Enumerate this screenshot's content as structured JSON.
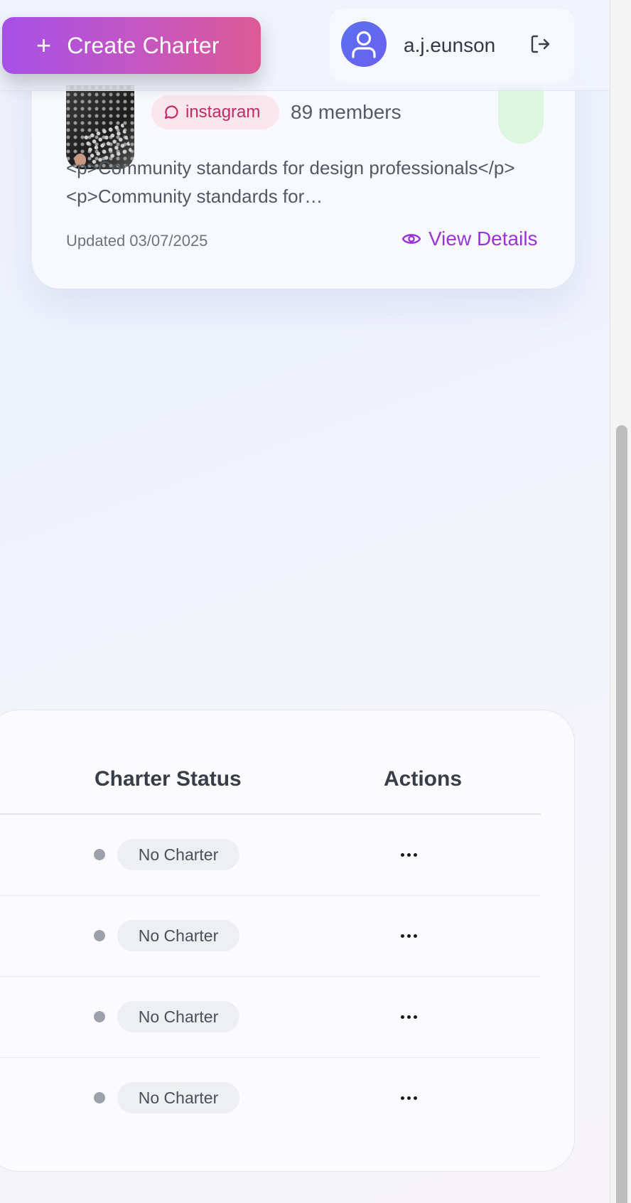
{
  "header": {
    "create_button_label": "Create Charter",
    "username": "a.j.eunson"
  },
  "charter_card": {
    "platform": "instagram",
    "members": "89 members",
    "description": "<p>Community standards for design professionals</p><p>Community standards for…",
    "updated": "Updated 03/07/2025",
    "view_details_label": "View Details"
  },
  "table": {
    "columns": [
      "Charter Status",
      "Actions"
    ],
    "rows": [
      {
        "status": "No Charter"
      },
      {
        "status": "No Charter"
      },
      {
        "status": "No Charter"
      },
      {
        "status": "No Charter"
      }
    ]
  },
  "colors": {
    "accent_gradient_start": "#a650e8",
    "accent_gradient_end": "#dd5a96",
    "link_purple": "#9a34d8",
    "instagram_badge_text": "#c22a62"
  }
}
